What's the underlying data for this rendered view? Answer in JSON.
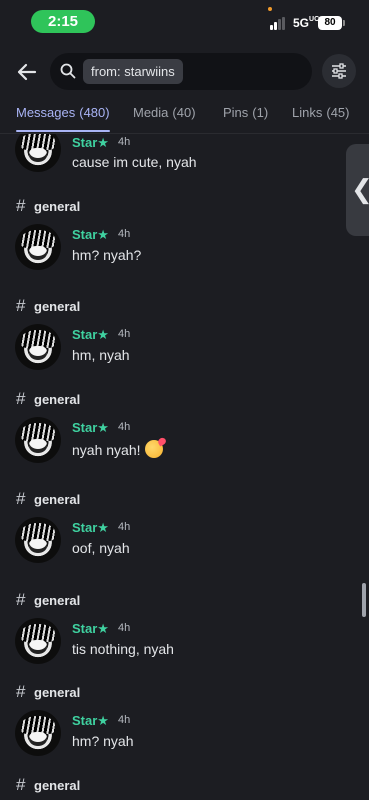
{
  "status_bar": {
    "time": "2:15",
    "network": "5G",
    "network_suffix": "UC",
    "battery": "80"
  },
  "search": {
    "filter_chip": "from: starwiins",
    "icons": {
      "back": "arrow-left-icon",
      "search": "search-icon",
      "filter": "sliders-icon"
    }
  },
  "tabs": [
    {
      "label": "Messages",
      "count": "(480)",
      "active": true
    },
    {
      "label": "Media",
      "count": "(40)",
      "active": false
    },
    {
      "label": "Pins",
      "count": "(1)",
      "active": false
    },
    {
      "label": "Links",
      "count": "(45)",
      "active": false
    }
  ],
  "results": [
    {
      "channel": "",
      "author": "Star★",
      "time": "4h",
      "text": "cause im cute, nyah"
    },
    {
      "channel": "general",
      "author": "Star★",
      "time": "4h",
      "text": "hm? nyah?"
    },
    {
      "channel": "general",
      "author": "Star★",
      "time": "4h",
      "text": "hm, nyah"
    },
    {
      "channel": "general",
      "author": "Star★",
      "time": "4h",
      "text": "nyah nyah!",
      "emoji": "smiling-face-with-hearts"
    },
    {
      "channel": "general",
      "author": "Star★",
      "time": "4h",
      "text": "oof, nyah"
    },
    {
      "channel": "general",
      "author": "Star★",
      "time": "4h",
      "text": "tis nothing, nyah"
    },
    {
      "channel": "general",
      "author": "Star★",
      "time": "4h",
      "text": "hm? nyah"
    },
    {
      "channel": "general",
      "author": "",
      "time": "",
      "text": ""
    }
  ],
  "colors": {
    "background": "#1c1d22",
    "author": "#3fd1a0",
    "active_tab": "#a9b4f5",
    "time_pill": "#2fc45a"
  }
}
